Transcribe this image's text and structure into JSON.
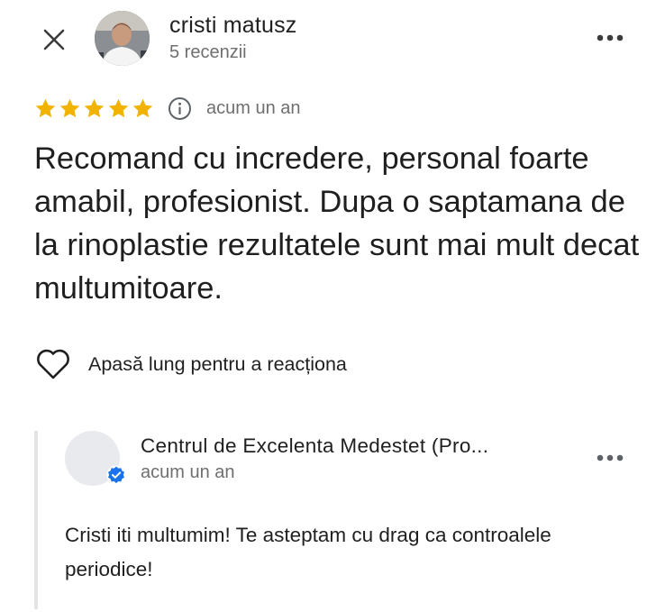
{
  "review": {
    "reviewer_name": "cristi matusz",
    "reviewer_meta": "5 recenzii",
    "rating": 5,
    "date": "acum un an",
    "text": "Recomand cu incredere, personal foarte amabil, profesionist. Dupa o saptamana de la rinoplastie rezultatele sunt mai mult decat multumitoare.",
    "reaction_label": "Apasă lung pentru a reacționa"
  },
  "reply": {
    "business_name": "Centrul de Excelenta Medestet (Pro...",
    "date": "acum un an",
    "text": "Cristi iti multumim! Te asteptam cu drag ca controalele periodice!"
  },
  "colors": {
    "star": "#f2b300",
    "verified": "#1a73e8",
    "secondary_text": "#6f6f6f"
  },
  "icons": {
    "close": "close-icon",
    "more": "more-horizontal-icon",
    "info": "info-icon",
    "heart": "heart-outline-icon",
    "verified": "verified-badge-icon"
  }
}
